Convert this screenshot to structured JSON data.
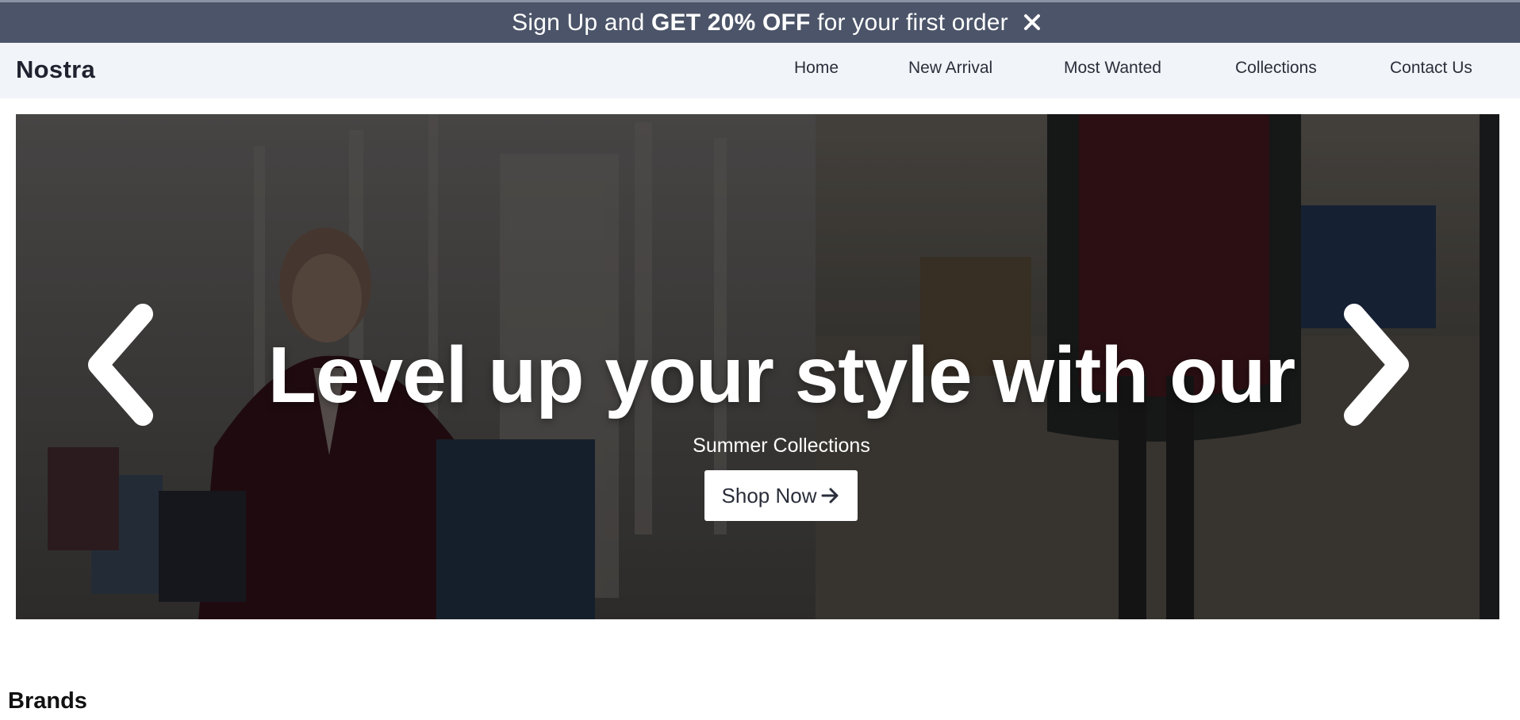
{
  "promo": {
    "segments": [
      {
        "text": "Sign Up and ",
        "bold": false
      },
      {
        "text": "GET 20% OFF",
        "bold": true
      },
      {
        "text": " for your first order",
        "bold": false
      }
    ],
    "close_icon": "close-icon",
    "background": "#4b5468"
  },
  "header": {
    "logo": "Nostra",
    "nav": [
      "Home",
      "New Arrival",
      "Most Wanted",
      "Collections",
      "Contact Us"
    ],
    "background": "#f1f5f9"
  },
  "hero": {
    "title": "Level up your style with our",
    "subtitle": "Summer Collections",
    "cta_label": "Shop Now",
    "cta_icon": "arrow-right-icon",
    "prev_icon": "chevron-left-icon",
    "next_icon": "chevron-right-icon"
  },
  "brands": {
    "title": "Brands"
  }
}
